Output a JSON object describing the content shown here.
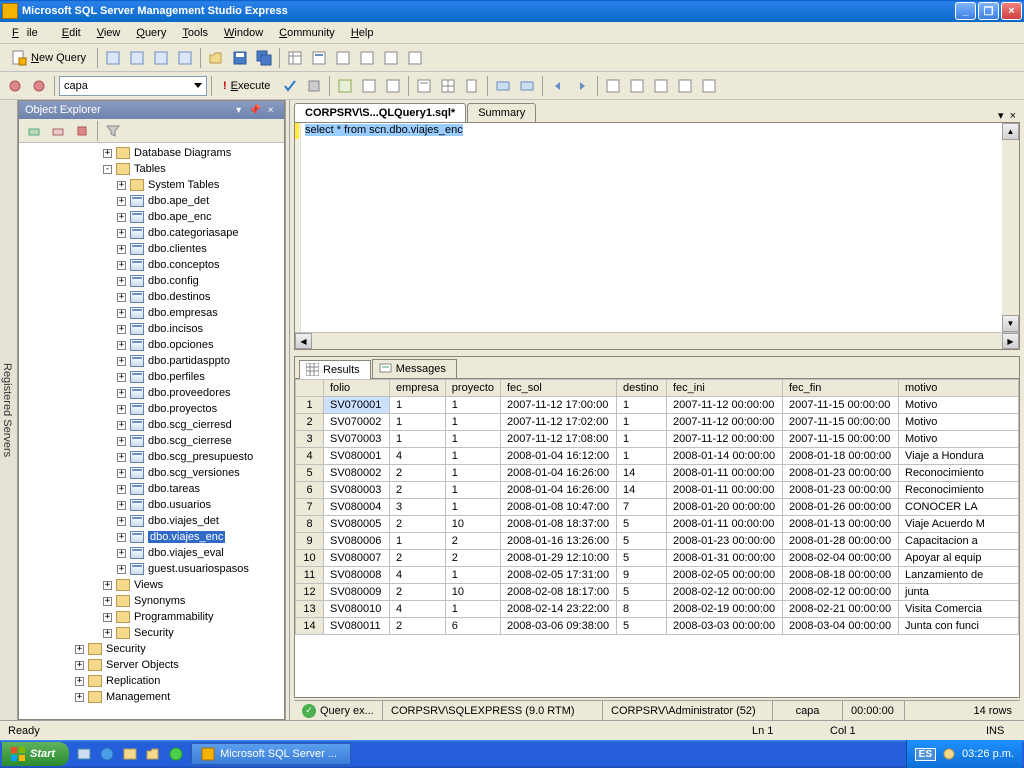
{
  "title": "Microsoft SQL Server Management Studio Express",
  "menu": {
    "file": "File",
    "edit": "Edit",
    "view": "View",
    "query": "Query",
    "tools": "Tools",
    "window": "Window",
    "community": "Community",
    "help": "Help"
  },
  "toolbar": {
    "newquery": "New Query",
    "execute": "Execute"
  },
  "dbselector": "capa",
  "objexp": {
    "title": "Object Explorer",
    "nodes": [
      {
        "label": "Database Diagrams",
        "level": 6,
        "icon": "folder",
        "exp": "+"
      },
      {
        "label": "Tables",
        "level": 6,
        "icon": "folder",
        "exp": "-"
      },
      {
        "label": "System Tables",
        "level": 7,
        "icon": "folder",
        "exp": "+"
      },
      {
        "label": "dbo.ape_det",
        "level": 7,
        "icon": "table",
        "exp": "+"
      },
      {
        "label": "dbo.ape_enc",
        "level": 7,
        "icon": "table",
        "exp": "+"
      },
      {
        "label": "dbo.categoriasape",
        "level": 7,
        "icon": "table",
        "exp": "+"
      },
      {
        "label": "dbo.clientes",
        "level": 7,
        "icon": "table",
        "exp": "+"
      },
      {
        "label": "dbo.conceptos",
        "level": 7,
        "icon": "table",
        "exp": "+"
      },
      {
        "label": "dbo.config",
        "level": 7,
        "icon": "table",
        "exp": "+"
      },
      {
        "label": "dbo.destinos",
        "level": 7,
        "icon": "table",
        "exp": "+"
      },
      {
        "label": "dbo.empresas",
        "level": 7,
        "icon": "table",
        "exp": "+"
      },
      {
        "label": "dbo.incisos",
        "level": 7,
        "icon": "table",
        "exp": "+"
      },
      {
        "label": "dbo.opciones",
        "level": 7,
        "icon": "table",
        "exp": "+"
      },
      {
        "label": "dbo.partidasppto",
        "level": 7,
        "icon": "table",
        "exp": "+"
      },
      {
        "label": "dbo.perfiles",
        "level": 7,
        "icon": "table",
        "exp": "+"
      },
      {
        "label": "dbo.proveedores",
        "level": 7,
        "icon": "table",
        "exp": "+"
      },
      {
        "label": "dbo.proyectos",
        "level": 7,
        "icon": "table",
        "exp": "+"
      },
      {
        "label": "dbo.scg_cierresd",
        "level": 7,
        "icon": "table",
        "exp": "+"
      },
      {
        "label": "dbo.scg_cierrese",
        "level": 7,
        "icon": "table",
        "exp": "+"
      },
      {
        "label": "dbo.scg_presupuesto",
        "level": 7,
        "icon": "table",
        "exp": "+"
      },
      {
        "label": "dbo.scg_versiones",
        "level": 7,
        "icon": "table",
        "exp": "+"
      },
      {
        "label": "dbo.tareas",
        "level": 7,
        "icon": "table",
        "exp": "+"
      },
      {
        "label": "dbo.usuarios",
        "level": 7,
        "icon": "table",
        "exp": "+"
      },
      {
        "label": "dbo.viajes_det",
        "level": 7,
        "icon": "table",
        "exp": "+"
      },
      {
        "label": "dbo.viajes_enc",
        "level": 7,
        "icon": "table",
        "exp": "+",
        "sel": true
      },
      {
        "label": "dbo.viajes_eval",
        "level": 7,
        "icon": "table",
        "exp": "+"
      },
      {
        "label": "guest.usuariospasos",
        "level": 7,
        "icon": "table",
        "exp": "+"
      },
      {
        "label": "Views",
        "level": 6,
        "icon": "folder",
        "exp": "+"
      },
      {
        "label": "Synonyms",
        "level": 6,
        "icon": "folder",
        "exp": "+"
      },
      {
        "label": "Programmability",
        "level": 6,
        "icon": "folder",
        "exp": "+"
      },
      {
        "label": "Security",
        "level": 6,
        "icon": "folder",
        "exp": "+"
      },
      {
        "label": "Security",
        "level": 4,
        "icon": "folder",
        "exp": "+"
      },
      {
        "label": "Server Objects",
        "level": 4,
        "icon": "folder",
        "exp": "+"
      },
      {
        "label": "Replication",
        "level": 4,
        "icon": "folder",
        "exp": "+"
      },
      {
        "label": "Management",
        "level": 4,
        "icon": "folder",
        "exp": "+"
      }
    ]
  },
  "sidetab": "Registered Servers",
  "doc": {
    "tab1": "CORPSRV\\S...QLQuery1.sql*",
    "tab2": "Summary"
  },
  "sql": "select * from scn.dbo.viajes_enc",
  "results": {
    "tab_results": "Results",
    "tab_messages": "Messages",
    "columns": [
      "",
      "folio",
      "empresa",
      "proyecto",
      "fec_sol",
      "destino",
      "fec_ini",
      "fec_fin",
      "motivo"
    ],
    "rows": [
      [
        "1",
        "SV070001",
        "1",
        "1",
        "2007-11-12 17:00:00",
        "1",
        "2007-11-12 00:00:00",
        "2007-11-15 00:00:00",
        "Motivo"
      ],
      [
        "2",
        "SV070002",
        "1",
        "1",
        "2007-11-12 17:02:00",
        "1",
        "2007-11-12 00:00:00",
        "2007-11-15 00:00:00",
        "Motivo"
      ],
      [
        "3",
        "SV070003",
        "1",
        "1",
        "2007-11-12 17:08:00",
        "1",
        "2007-11-12 00:00:00",
        "2007-11-15 00:00:00",
        "Motivo"
      ],
      [
        "4",
        "SV080001",
        "4",
        "1",
        "2008-01-04 16:12:00",
        "1",
        "2008-01-14 00:00:00",
        "2008-01-18 00:00:00",
        "Viaje a Hondura"
      ],
      [
        "5",
        "SV080002",
        "2",
        "1",
        "2008-01-04 16:26:00",
        "14",
        "2008-01-11 00:00:00",
        "2008-01-23 00:00:00",
        "Reconocimiento"
      ],
      [
        "6",
        "SV080003",
        "2",
        "1",
        "2008-01-04 16:26:00",
        "14",
        "2008-01-11 00:00:00",
        "2008-01-23 00:00:00",
        "Reconocimiento"
      ],
      [
        "7",
        "SV080004",
        "3",
        "1",
        "2008-01-08 10:47:00",
        "7",
        "2008-01-20 00:00:00",
        "2008-01-26 00:00:00",
        "CONOCER LA"
      ],
      [
        "8",
        "SV080005",
        "2",
        "10",
        "2008-01-08 18:37:00",
        "5",
        "2008-01-11 00:00:00",
        "2008-01-13 00:00:00",
        "Viaje Acuerdo M"
      ],
      [
        "9",
        "SV080006",
        "1",
        "2",
        "2008-01-16 13:26:00",
        "5",
        "2008-01-23 00:00:00",
        "2008-01-28 00:00:00",
        "Capacitacion a"
      ],
      [
        "10",
        "SV080007",
        "2",
        "2",
        "2008-01-29 12:10:00",
        "5",
        "2008-01-31 00:00:00",
        "2008-02-04 00:00:00",
        "Apoyar al equip"
      ],
      [
        "11",
        "SV080008",
        "4",
        "1",
        "2008-02-05 17:31:00",
        "9",
        "2008-02-05 00:00:00",
        "2008-08-18 00:00:00",
        "Lanzamiento de"
      ],
      [
        "12",
        "SV080009",
        "2",
        "10",
        "2008-02-08 18:17:00",
        "5",
        "2008-02-12 00:00:00",
        "2008-02-12 00:00:00",
        "junta"
      ],
      [
        "13",
        "SV080010",
        "4",
        "1",
        "2008-02-14 23:22:00",
        "8",
        "2008-02-19 00:00:00",
        "2008-02-21 00:00:00",
        "Visita Comercia"
      ],
      [
        "14",
        "SV080011",
        "2",
        "6",
        "2008-03-06 09:38:00",
        "5",
        "2008-03-03 00:00:00",
        "2008-03-04 00:00:00",
        "Junta con funci"
      ]
    ]
  },
  "statusstrip": {
    "query": "Query  ex...",
    "server": "CORPSRV\\SQLEXPRESS (9.0 RTM)",
    "user": "CORPSRV\\Administrator (52)",
    "db": "capa",
    "time": "00:00:00",
    "rows": "14 rows"
  },
  "bottomstatus": {
    "ready": "Ready",
    "ln": "Ln 1",
    "col": "Col 1",
    "ch": "",
    "ins": "INS"
  },
  "taskbar": {
    "start": "Start",
    "task1": "Microsoft SQL Server ...",
    "lang": "ES",
    "clock": "03:26 p.m."
  }
}
